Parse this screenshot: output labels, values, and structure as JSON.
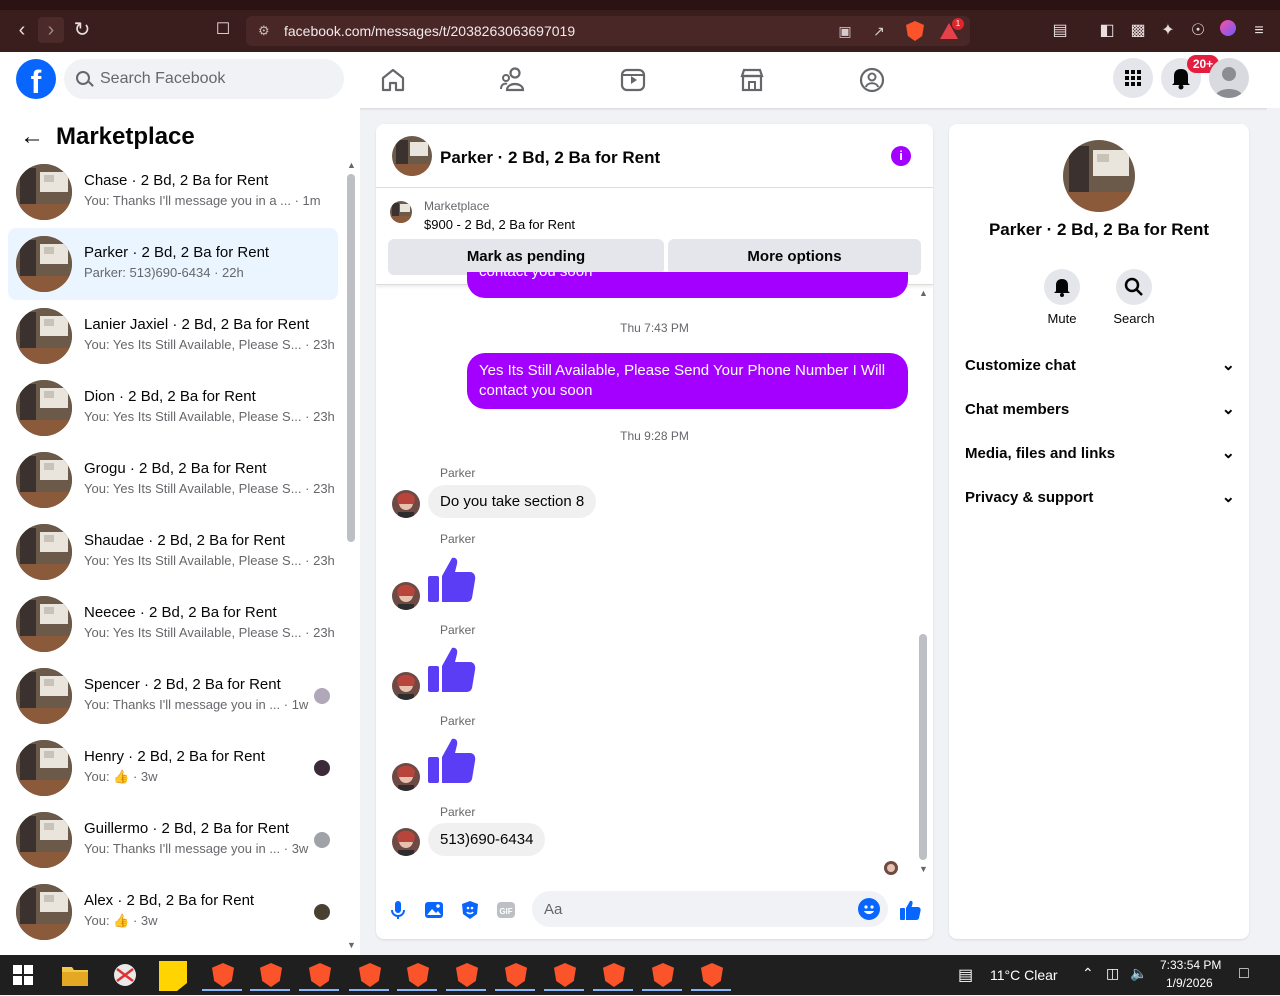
{
  "browser": {
    "url": "facebook.com/messages/t/2038263063697019",
    "bat_badge": "1"
  },
  "header": {
    "search_placeholder": "Search Facebook",
    "notifications_badge": "20+",
    "brand_color": "#0866ff"
  },
  "sidebar": {
    "title": "Marketplace",
    "conversations": [
      {
        "name": "Chase · 2 Bd, 2 Ba for Rent",
        "snippet": "You: Thanks I'll message you in a ... · 1m"
      },
      {
        "name": "Parker · 2 Bd, 2 Ba for Rent",
        "snippet": "Parker: 513)690-6434 · 22h"
      },
      {
        "name": "Lanier Jaxiel · 2 Bd, 2 Ba for Rent",
        "snippet": "You: Yes Its Still Available, Please S... · 23h"
      },
      {
        "name": "Dion · 2 Bd, 2 Ba for Rent",
        "snippet": "You: Yes Its Still Available, Please S... · 23h"
      },
      {
        "name": "Grogu · 2 Bd, 2 Ba for Rent",
        "snippet": "You: Yes Its Still Available, Please S... · 23h"
      },
      {
        "name": "Shaudae · 2 Bd, 2 Ba for Rent",
        "snippet": "You: Yes Its Still Available, Please S... · 23h"
      },
      {
        "name": "Neecee · 2 Bd, 2 Ba for Rent",
        "snippet": "You: Yes Its Still Available, Please S... · 23h"
      },
      {
        "name": "Spencer · 2 Bd, 2 Ba for Rent",
        "snippet": "You: Thanks I'll message you in ... · 1w"
      },
      {
        "name": "Henry · 2 Bd, 2 Ba for Rent",
        "snippet": "You: 👍 · 3w"
      },
      {
        "name": "Guillermo · 2 Bd, 2 Ba for Rent",
        "snippet": "You: Thanks I'll message you in ... · 3w"
      },
      {
        "name": "Alex · 2 Bd, 2 Ba for Rent",
        "snippet": "You: 👍 · 3w"
      }
    ]
  },
  "chat": {
    "title": "Parker · 2 Bd, 2 Ba for Rent",
    "listing_category": "Marketplace",
    "listing_price": "$900 - 2 Bd, 2 Ba for Rent",
    "mark_pending": "Mark as pending",
    "more_options": "More options",
    "partial_top": "contact you soon",
    "time1": "Thu 7:43 PM",
    "out_message": "Yes Its Still Available, Please Send Your Phone Number I Will contact you soon",
    "time2": "Thu 9:28 PM",
    "sender": "Parker",
    "in_message1": "Do you take section 8",
    "in_message_last": "513)690-6434",
    "composer_placeholder": "Aa",
    "accent": "#a400ff"
  },
  "details": {
    "name": "Parker · 2 Bd, 2 Ba for Rent",
    "mute": "Mute",
    "search": "Search",
    "sections": [
      "Customize chat",
      "Chat members",
      "Media, files and links",
      "Privacy & support"
    ]
  },
  "taskbar": {
    "weather": "11°C  Clear",
    "time": "7:33:54 PM",
    "date": "1/9/2026"
  }
}
